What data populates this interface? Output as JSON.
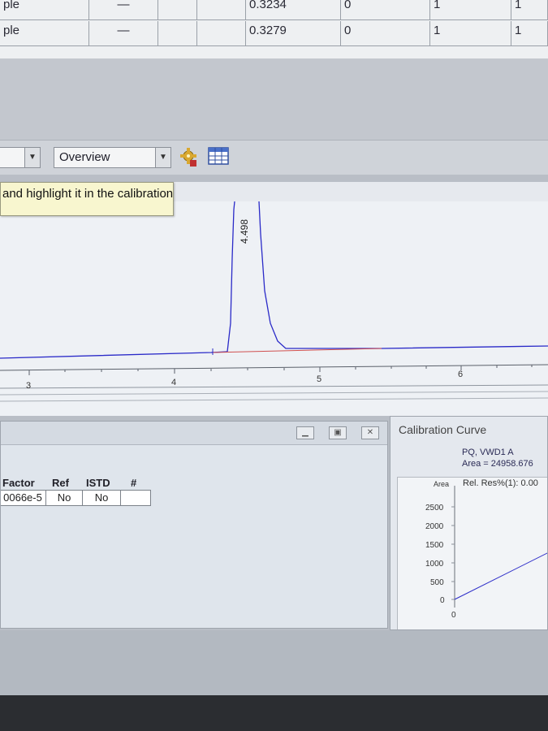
{
  "sample_table": {
    "rows": [
      {
        "name": "ple",
        "col2": "—",
        "amount": "0.3234",
        "c4": "0",
        "c5": "1",
        "c6": "1"
      },
      {
        "name": "ple",
        "col2": "—",
        "amount": "0.3279",
        "c4": "0",
        "c5": "1",
        "c6": "1"
      }
    ]
  },
  "toolbar": {
    "left_combo_value": "",
    "view_combo_value": "Overview",
    "icons": [
      "calibration-settings-icon",
      "table-grid-icon"
    ]
  },
  "tooltip": {
    "text": "and highlight it in the calibration"
  },
  "chromatogram": {
    "peak_label": "4.498",
    "x_ticks": [
      "3",
      "4",
      "5",
      "6"
    ]
  },
  "compound_table": {
    "headers": [
      "Factor",
      "Ref",
      "ISTD",
      "#"
    ],
    "row": {
      "factor": "0066e-5",
      "ref": "No",
      "istd": "No",
      "count": ""
    }
  },
  "calibration": {
    "title": "Calibration Curve",
    "signal": "PQ, VWD1 A",
    "area_text": "Area = 24958.676",
    "axis_label": "Area",
    "rel_res": "Rel. Res%(1): 0.00",
    "y_ticks": [
      "2500",
      "2000",
      "1500",
      "1000",
      "500",
      "0"
    ],
    "x_tick": "0"
  },
  "colors": {
    "trace": "#2a2ac8",
    "baseline": "#d05050",
    "tooltip_bg": "#f8f6cf"
  }
}
